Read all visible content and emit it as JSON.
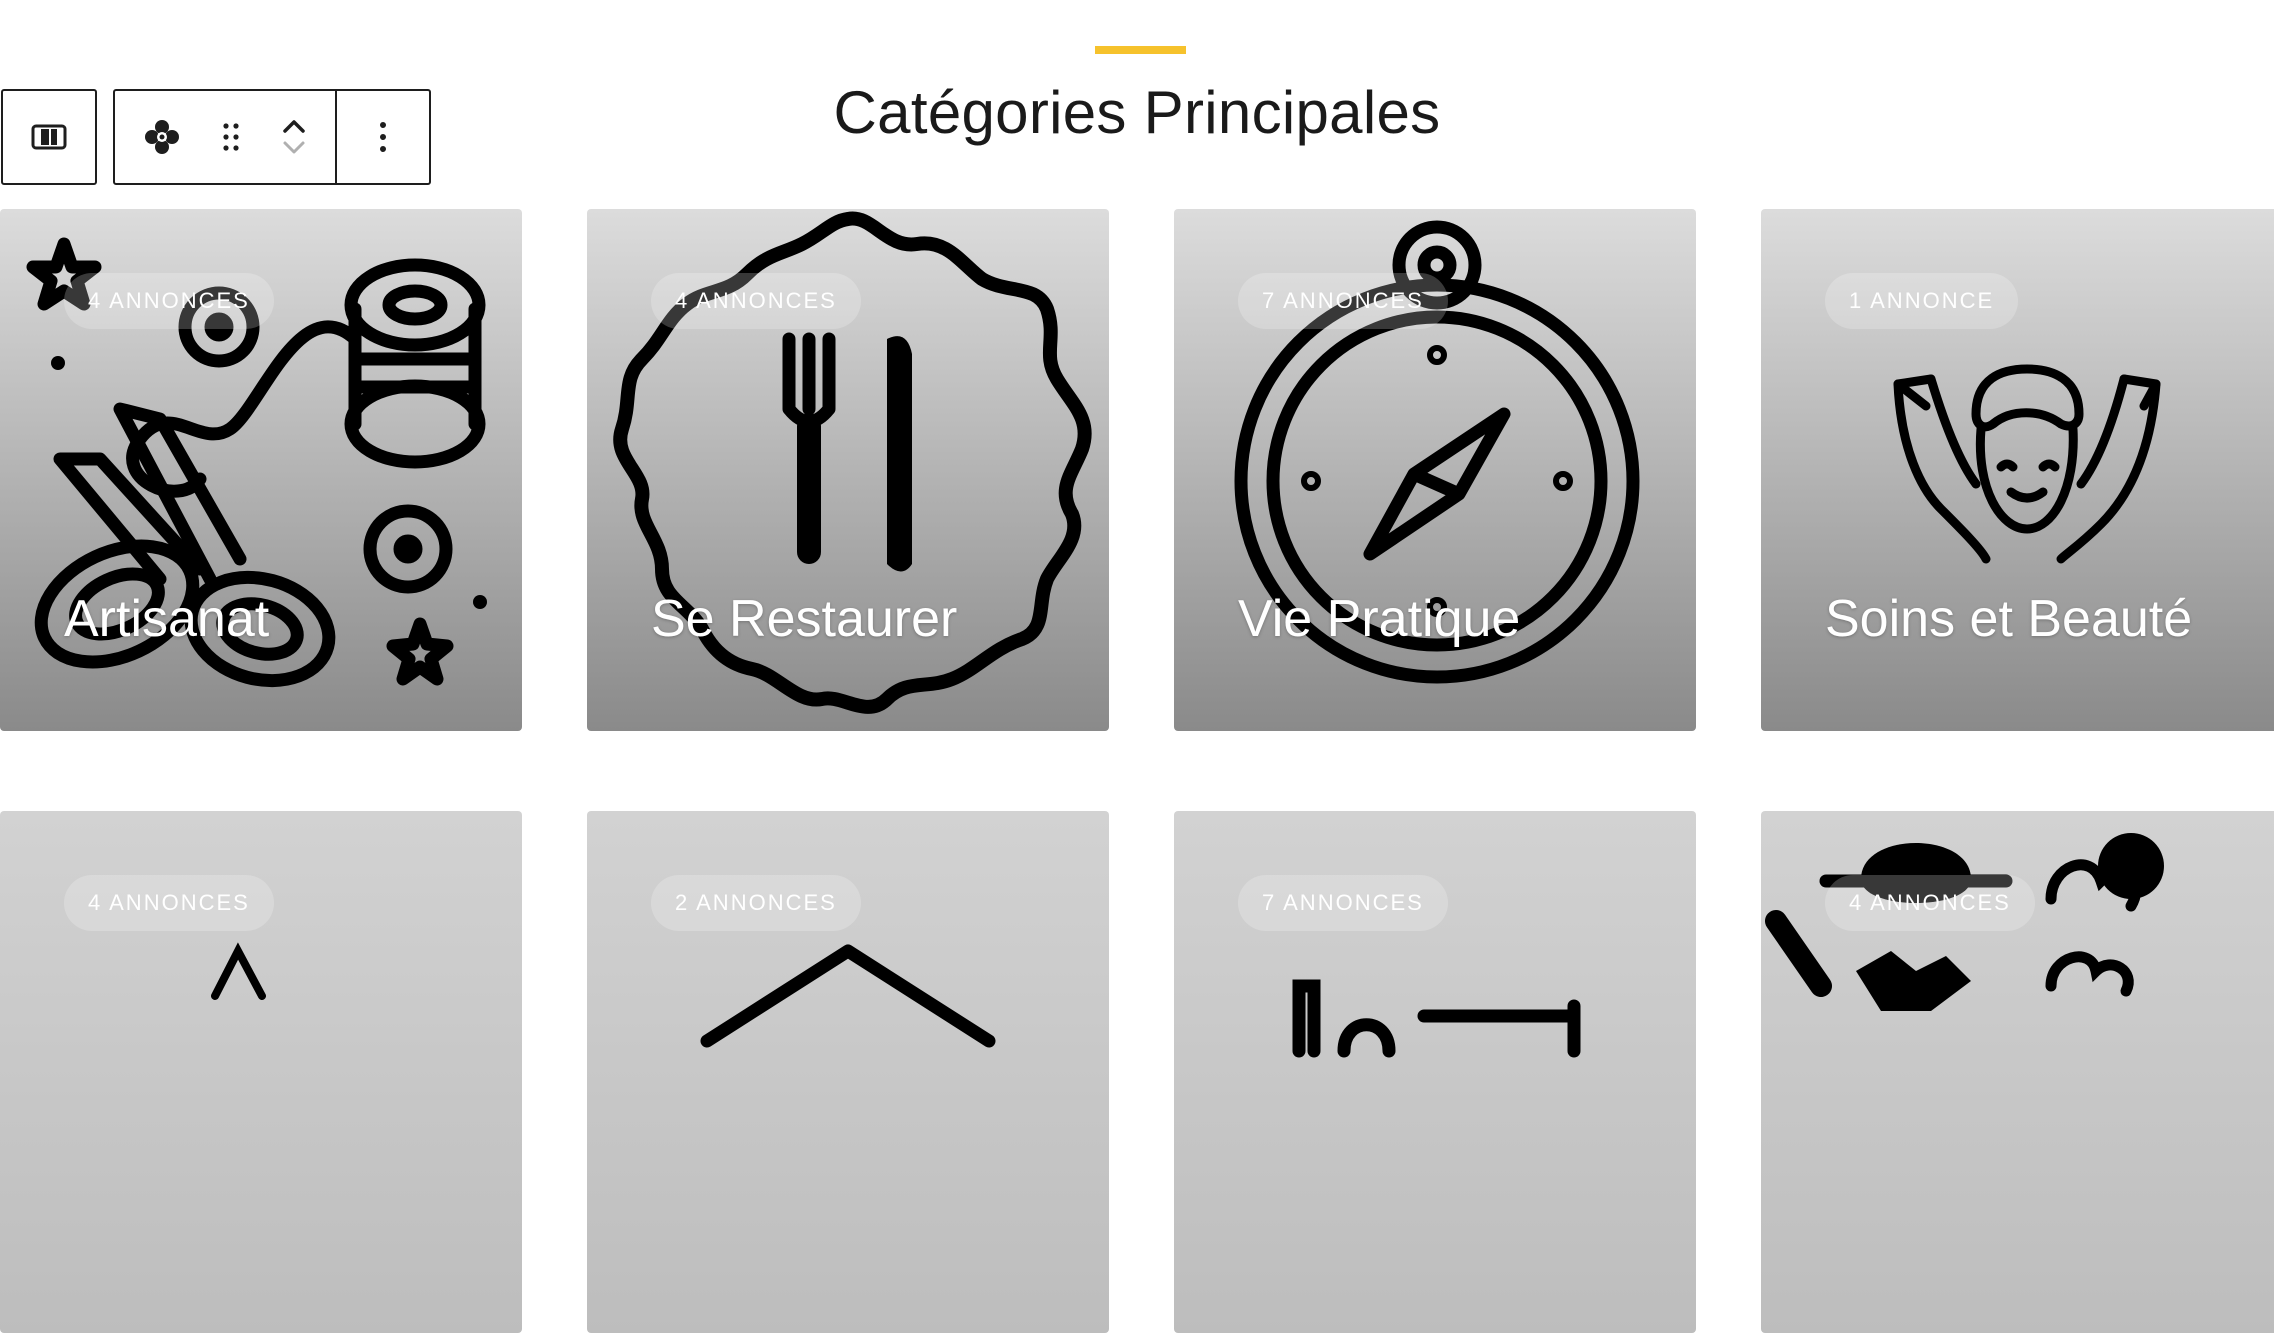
{
  "section": {
    "title": "Catégories Principales",
    "accent_color": "#f6c22c"
  },
  "toolbar": {
    "groups": [
      {
        "items": [
          "block-type-icon"
        ]
      },
      {
        "items": [
          "plugin-icon",
          "drag-handle-icon",
          "move-up-icon",
          "move-down-icon"
        ]
      },
      {
        "items": [
          "more-options-icon"
        ]
      }
    ]
  },
  "categories": [
    {
      "name": "Artisanat",
      "count_label": "4 ANNONCES",
      "icon": "crafts-scissors-spool-icon"
    },
    {
      "name": "Se Restaurer",
      "count_label": "4 ANNONCES",
      "icon": "fork-knife-badge-icon"
    },
    {
      "name": "Vie Pratique",
      "count_label": "7 ANNONCES",
      "icon": "compass-icon"
    },
    {
      "name": "Soins et Beauté",
      "count_label": "1 ANNONCE",
      "icon": "spa-face-hands-icon"
    },
    {
      "name": "",
      "count_label": "4 ANNONCES",
      "icon": "basket-icon"
    },
    {
      "name": "",
      "count_label": "2 ANNONCES",
      "icon": "house-icon"
    },
    {
      "name": "",
      "count_label": "7 ANNONCES",
      "icon": "tools-icon"
    },
    {
      "name": "",
      "count_label": "4 ANNONCES",
      "icon": "beach-person-icon"
    }
  ]
}
